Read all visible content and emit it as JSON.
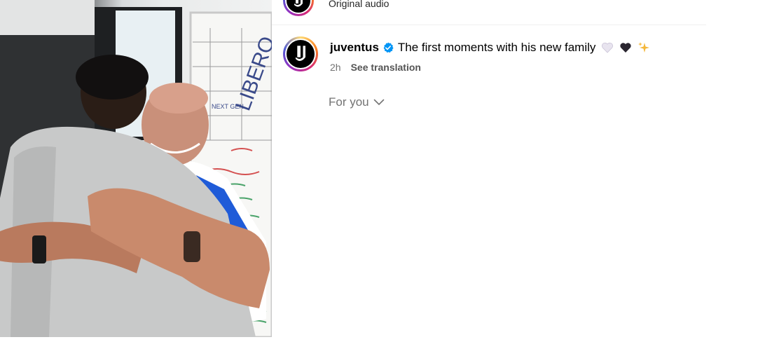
{
  "media": {
    "board_texts": [
      "LIBERO",
      "NEXT GEN"
    ]
  },
  "top": {
    "audio_label": "Original audio"
  },
  "post": {
    "username": "juventus",
    "verified_icon": "verified-badge-icon",
    "caption": "The first moments with his new family",
    "emojis": [
      "white-heart-icon",
      "black-heart-icon",
      "sparkles-icon"
    ],
    "time": "2h",
    "see_translation": "See translation"
  },
  "feed": {
    "for_you": "For you",
    "chevron_icon": "chevron-down-icon"
  },
  "colors": {
    "verified": "#0095f6",
    "muted": "#737373"
  }
}
